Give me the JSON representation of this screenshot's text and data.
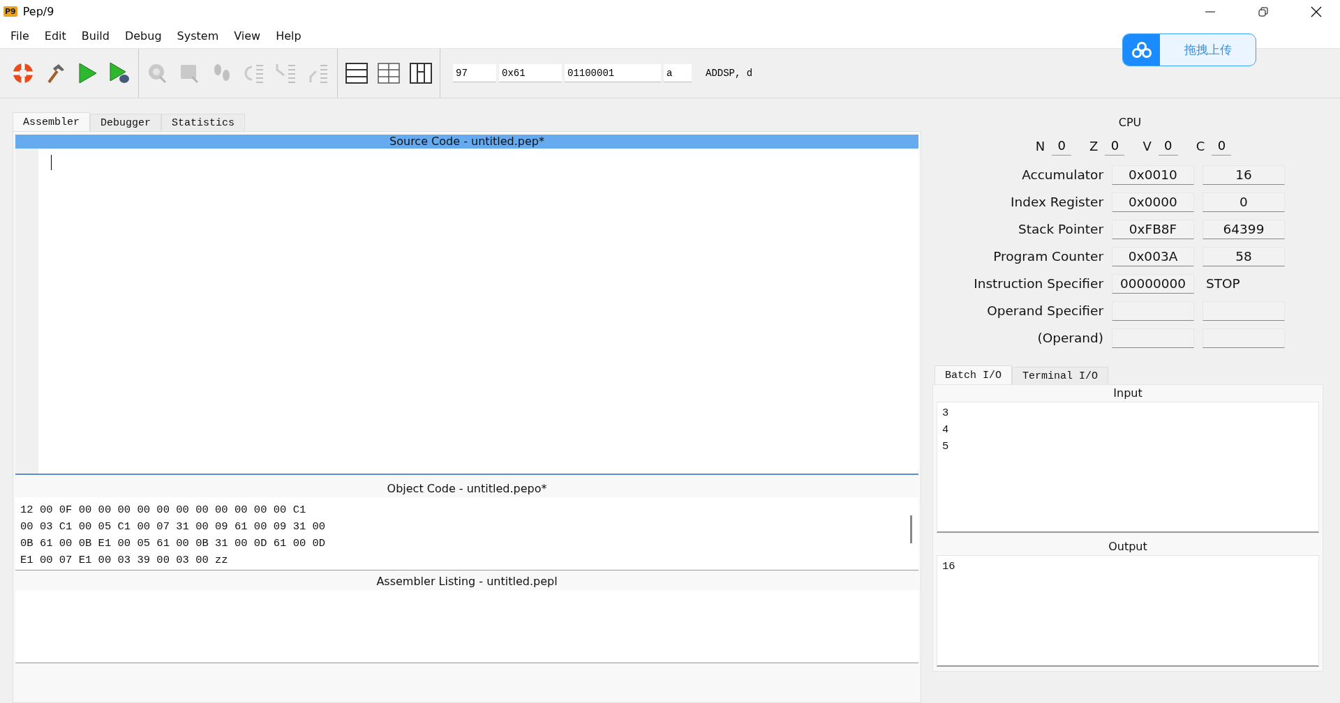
{
  "window": {
    "app_icon": "P9",
    "title": "Pep/9"
  },
  "menu": [
    "File",
    "Edit",
    "Build",
    "Debug",
    "System",
    "View",
    "Help"
  ],
  "toolbar": {
    "groups": [
      [
        {
          "kind": "lifebuoy",
          "disabled": false
        },
        {
          "kind": "hammer",
          "disabled": false
        },
        {
          "kind": "run",
          "disabled": false
        },
        {
          "kind": "run-debug",
          "disabled": false
        }
      ],
      [
        {
          "kind": "source-step",
          "disabled": true
        },
        {
          "kind": "object-step",
          "disabled": true
        },
        {
          "kind": "footprints",
          "disabled": true
        },
        {
          "kind": "step-over",
          "disabled": true
        },
        {
          "kind": "step-into",
          "disabled": true
        },
        {
          "kind": "step-out",
          "disabled": true
        }
      ],
      [
        {
          "kind": "layout-rows",
          "disabled": false
        },
        {
          "kind": "layout-split",
          "disabled": false
        },
        {
          "kind": "layout-columns",
          "disabled": false
        }
      ]
    ],
    "fields": [
      "97",
      "0x61",
      "01100001",
      "a"
    ],
    "instruction": "ADDSP, d"
  },
  "upload_button": {
    "label": "拖拽上传"
  },
  "tabs": [
    {
      "label": "Assembler",
      "selected": true
    },
    {
      "label": "Debugger",
      "selected": false
    },
    {
      "label": "Statistics",
      "selected": false
    }
  ],
  "source": {
    "title": "Source Code - untitled.pep*"
  },
  "object_code": {
    "title": "Object Code - untitled.pepo*",
    "lines": [
      "12 00 0F 00 00 00 00 00 00 00 00 00 00 00 C1",
      "00 03 C1 00 05 C1 00 07 31 00 09 61 00 09 31 00",
      "0B 61 00 0B E1 00 05 61 00 0B 31 00 0D 61 00 0D",
      "E1 00 07 E1 00 03 39 00 03 00 zz"
    ]
  },
  "listing": {
    "title": "Assembler Listing - untitled.pepl"
  },
  "cpu": {
    "title": "CPU",
    "flags": [
      {
        "name": "N",
        "value": "0"
      },
      {
        "name": "Z",
        "value": "0"
      },
      {
        "name": "V",
        "value": "0"
      },
      {
        "name": "C",
        "value": "0"
      }
    ],
    "registers": [
      {
        "label": "Accumulator",
        "cells": [
          {
            "kind": "field",
            "text": "0x0010"
          },
          {
            "kind": "field",
            "text": "16"
          }
        ]
      },
      {
        "label": "Index Register",
        "cells": [
          {
            "kind": "field",
            "text": "0x0000"
          },
          {
            "kind": "field",
            "text": "0"
          }
        ]
      },
      {
        "label": "Stack Pointer",
        "cells": [
          {
            "kind": "field",
            "text": "0xFB8F"
          },
          {
            "kind": "field",
            "text": "64399"
          }
        ]
      },
      {
        "label": "Program Counter",
        "cells": [
          {
            "kind": "field",
            "text": "0x003A"
          },
          {
            "kind": "field",
            "text": "58"
          }
        ]
      },
      {
        "label": "Instruction Specifier",
        "cells": [
          {
            "kind": "field",
            "text": "00000000"
          },
          {
            "kind": "text",
            "text": "STOP"
          }
        ]
      },
      {
        "label": "Operand Specifier",
        "cells": [
          {
            "kind": "field"
          },
          {
            "kind": "field"
          }
        ]
      },
      {
        "label": "(Operand)",
        "cells": [
          {
            "kind": "field"
          },
          {
            "kind": "field"
          }
        ]
      }
    ]
  },
  "io_tabs": [
    {
      "label": "Batch I/O",
      "selected": true
    },
    {
      "label": "Terminal I/O",
      "selected": false
    }
  ],
  "input": {
    "title": "Input",
    "lines": [
      "3",
      "4",
      "5"
    ]
  },
  "output": {
    "title": "Output",
    "lines": [
      "16"
    ]
  }
}
